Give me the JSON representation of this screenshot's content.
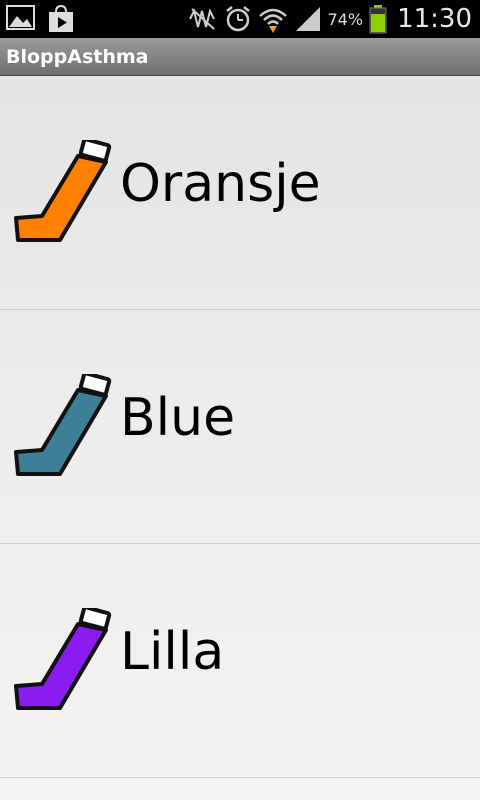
{
  "status_bar": {
    "battery_percent": "74%",
    "time": "11:30"
  },
  "app": {
    "title": "BloppAsthma"
  },
  "inhalers": [
    {
      "label": "Oransje",
      "color": "#ff8000"
    },
    {
      "label": "Blue",
      "color": "#3c7f97"
    },
    {
      "label": "Lilla",
      "color": "#8a1cf0"
    }
  ]
}
